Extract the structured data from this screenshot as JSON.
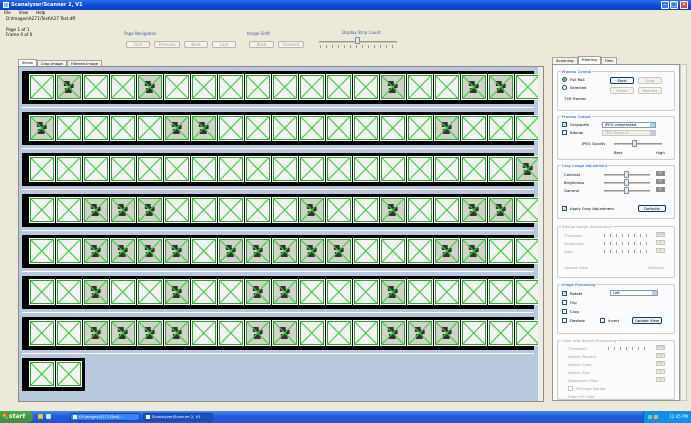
{
  "window": {
    "title": "Scanalyzer/Scanner 2, V1",
    "menu": [
      "File",
      "View",
      "Help"
    ]
  },
  "info": {
    "path": "D:\\Images\\A271\\Test\\A27 Test.dff",
    "page": "Page 1 of 1",
    "frame": "Frame 0 of 0"
  },
  "page_navigation": {
    "label": "Page Navigation",
    "buttons": [
      "First",
      "Previous",
      "Next",
      "Last"
    ]
  },
  "image_shift": {
    "label": "Image Shift",
    "buttons": [
      "Back",
      "Forward"
    ]
  },
  "strip_count": {
    "label": "Display Strip Count"
  },
  "viewer_tabs": [
    "Strips",
    "Crop Image",
    "Filtered Image"
  ],
  "strips": [
    {
      "frames": 19,
      "content": [
        1,
        4,
        13,
        16,
        17
      ]
    },
    {
      "frames": 19,
      "content": [
        0,
        5,
        6,
        15
      ]
    },
    {
      "frames": 19,
      "content": [
        18
      ]
    },
    {
      "frames": 19,
      "content": [
        2,
        3,
        4,
        10,
        13,
        16,
        17
      ]
    },
    {
      "frames": 19,
      "content": [
        2,
        3,
        4,
        5,
        7,
        8,
        9,
        10,
        11,
        15,
        16
      ]
    },
    {
      "frames": 19,
      "content": [
        2,
        5,
        8,
        9,
        13
      ]
    },
    {
      "frames": 19,
      "content": [
        2,
        3,
        4,
        5,
        8,
        9,
        13,
        14,
        15
      ]
    },
    {
      "frames": 2,
      "content": []
    }
  ],
  "right_tabs": [
    "Scanning",
    "Filtering",
    "Files"
  ],
  "process_control": {
    "title": "Process Control",
    "options": [
      "Full Roll",
      "Selected"
    ],
    "selected_option": "Full Roll",
    "frames_text": "749 Frames",
    "buttons": [
      "Start",
      "Stop",
      "Pause",
      "Resume"
    ]
  },
  "process_output": {
    "title": "Process Output",
    "bitonal_checked": true,
    "checks": [
      "Grayscale",
      "Bitonal"
    ],
    "format": "JPEG compressed",
    "bitonal_format": "TIFF Group 4",
    "quality_label": "JPEG Quality",
    "quality_low": "Best",
    "quality_high": "High"
  },
  "gray_adjust": {
    "title": "Gray Image Adjustment",
    "rows": [
      {
        "label": "Contrast",
        "value": "0"
      },
      {
        "label": "Brightness",
        "value": "0"
      },
      {
        "label": "Gamma",
        "value": "1"
      }
    ],
    "apply_label": "Apply Gray Adjustment",
    "defaults": "Defaults"
  },
  "bitonal_adjust": {
    "title": "Bitonal Image Adjustment",
    "rows": [
      {
        "label": "Threshold",
        "value": "128"
      },
      {
        "label": "Sensitivity",
        "value": "0"
      },
      {
        "label": "Type",
        "value": "0"
      }
    ],
    "update": "Update View",
    "defaults": "Defaults"
  },
  "image_processing": {
    "title": "Image Processing",
    "rotate": "Rotate",
    "rotate_value": "Left",
    "flip": "Flip",
    "crop": "Crop",
    "deskew": "Deskew",
    "invert": "Invert",
    "update": "Update View"
  },
  "color_process": {
    "title": "Color and Bitonal Processing",
    "rows": [
      {
        "label": "Threshold",
        "value": "128"
      },
      {
        "label": "Detect Percent",
        "value": "20"
      },
      {
        "label": "Detect Color",
        "value": "95"
      },
      {
        "label": "Detect Size",
        "value": "4"
      },
      {
        "label": "Despeckle Filter",
        "value": "0"
      }
    ],
    "fill_label": "Fill Edge Border",
    "last_label": "Edge Fill Color"
  },
  "taskbar": {
    "start": "start",
    "tasks": [
      "D:\\Images\\A271\\Test\\...",
      "Scanalyzer/Scanner 2, V1"
    ],
    "clock": "12:45 PM"
  }
}
